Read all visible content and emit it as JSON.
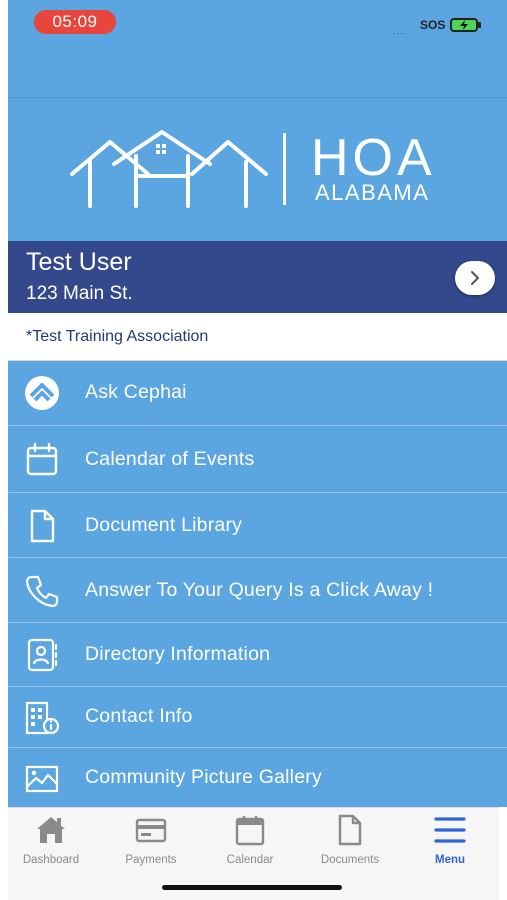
{
  "status_bar": {
    "time": "05:09",
    "signal": "....",
    "sos": "SOS"
  },
  "logo": {
    "title": "HOA",
    "subtitle": "ALABAMA"
  },
  "user": {
    "name": "Test User",
    "address": "123 Main St.",
    "association": "*Test Training Association"
  },
  "menu": {
    "items": [
      {
        "label": "Ask Cephai",
        "icon": "cephai-logo-icon"
      },
      {
        "label": "Calendar of Events",
        "icon": "calendar-icon"
      },
      {
        "label": "Document Library",
        "icon": "document-icon"
      },
      {
        "label": "Answer To Your Query Is a Click Away !",
        "icon": "phone-icon"
      },
      {
        "label": "Directory Information",
        "icon": "contact-card-icon"
      },
      {
        "label": "Contact Info",
        "icon": "building-info-icon"
      },
      {
        "label": "Community Picture Gallery",
        "icon": "image-gallery-icon"
      }
    ]
  },
  "tab_bar": {
    "tabs": [
      {
        "label": "Dashboard",
        "icon": "home-icon"
      },
      {
        "label": "Payments",
        "icon": "credit-card-icon"
      },
      {
        "label": "Calendar",
        "icon": "calendar-icon"
      },
      {
        "label": "Documents",
        "icon": "document-icon"
      },
      {
        "label": "Menu",
        "icon": "hamburger-menu-icon",
        "active": true
      }
    ]
  },
  "colors": {
    "primary_blue": "#5ba6e0",
    "navy": "#33498c",
    "active_tab": "#2f63d8",
    "time_pill": "#e8453c"
  }
}
